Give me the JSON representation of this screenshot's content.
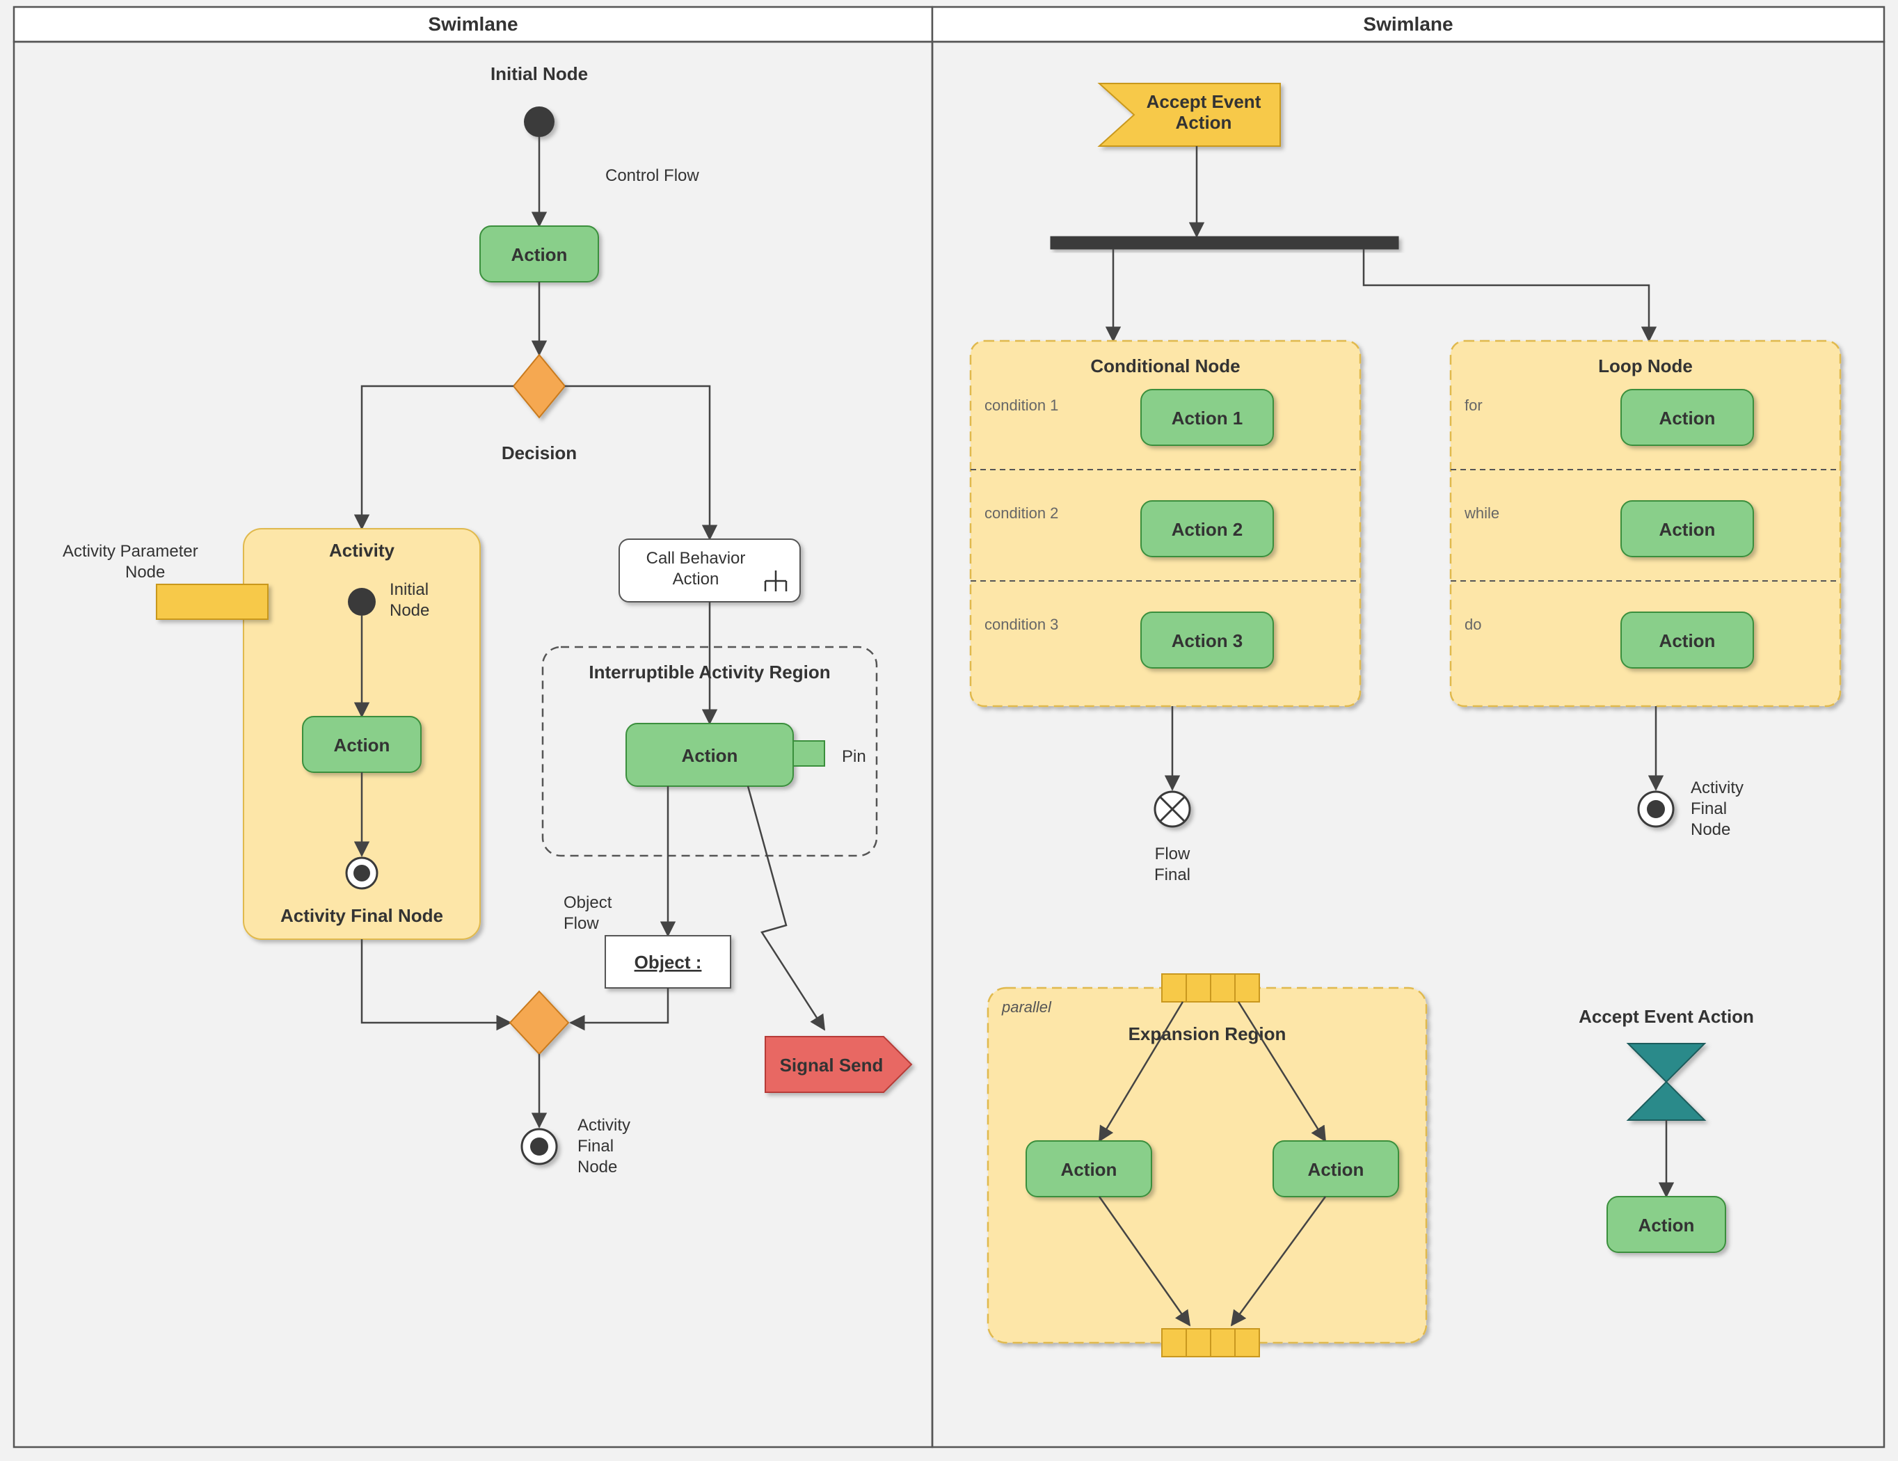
{
  "swimlanes": {
    "left_title": "Swimlane",
    "right_title": "Swimlane"
  },
  "left": {
    "initial_node": "Initial Node",
    "control_flow": "Control Flow",
    "action_top": "Action",
    "decision": "Decision",
    "activity_param": "Activity Parameter\nNode",
    "activity_box": {
      "title": "Activity",
      "initial_node": "Initial\nNode",
      "action": "Action",
      "final": "Activity Final Node"
    },
    "call_behavior": "Call Behavior\nAction",
    "interruptible": "Interruptible Activity Region",
    "action_in_region": "Action",
    "pin": "Pin",
    "object_flow": "Object\nFlow",
    "object": "Object :",
    "signal_send": "Signal Send",
    "bottom_final": "Activity\nFinal\nNode"
  },
  "right": {
    "accept_event": "Accept Event\nAction",
    "conditional": {
      "title": "Conditional Node",
      "cond1": "condition 1",
      "cond2": "condition 2",
      "cond3": "condition 3",
      "a1": "Action 1",
      "a2": "Action 2",
      "a3": "Action 3"
    },
    "loop": {
      "title": "Loop Node",
      "for": "for",
      "while": "while",
      "do": "do",
      "action": "Action"
    },
    "flow_final": "Flow\nFinal",
    "activity_final": "Activity\nFinal\nNode",
    "expansion": {
      "mode": "parallel",
      "title": "Expansion Region",
      "action": "Action"
    },
    "accept_event2": "Accept Event Action",
    "action_bottom": "Action"
  }
}
